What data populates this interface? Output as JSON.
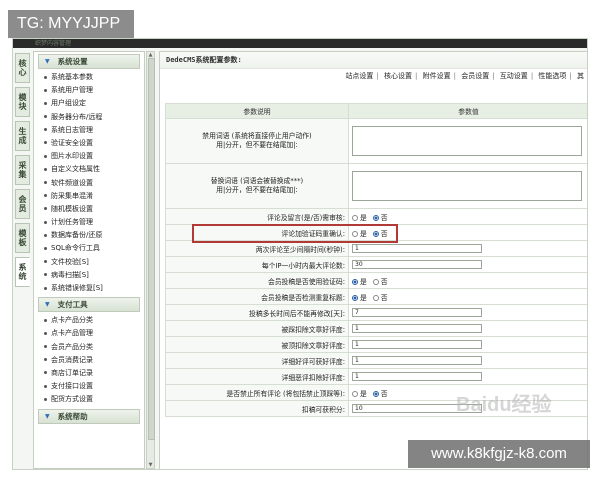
{
  "overlay": {
    "top_left": "TG: MYYJJPP",
    "bottom_right": "www.k8kfgjz-k8.com",
    "watermark": "Baidu经验"
  },
  "topbar": {
    "text": "织梦内容管理"
  },
  "vtabs": [
    "核心",
    "模块",
    "生成",
    "采集",
    "会员",
    "模板",
    "系统"
  ],
  "sidebar": {
    "section1": {
      "title": "系统设置",
      "items": [
        "系统基本参数",
        "系统用户管理",
        "用户组设定",
        "服务器分布/远程",
        "系统日志管理",
        "验证安全设置",
        "图片水印设置",
        "自定义文档属性",
        "软件频道设置",
        "防采集串混淆",
        "随机模板设置",
        "计划任务管理",
        "数据库备份/还原",
        "SQL命令行工具",
        "文件校验[S]",
        "病毒扫描[S]",
        "系统错误修复[S]"
      ]
    },
    "section2": {
      "title": "支付工具",
      "items": [
        "点卡产品分类",
        "点卡产品管理",
        "会员产品分类",
        "会员消费记录",
        "商店订单记录",
        "支付接口设置",
        "配货方式设置"
      ]
    },
    "section3": {
      "title": "系统帮助"
    }
  },
  "main": {
    "title": "DedeCMS系统配置参数:",
    "tabs": [
      "站点设置",
      "核心设置",
      "附件设置",
      "会员设置",
      "互动设置",
      "性能选项",
      "其"
    ],
    "col_label": "参数说明",
    "col_value": "参数值",
    "rows": [
      {
        "label1": "禁用词语 (系统将直接停止用户动作)",
        "label2": "用|分开，但不要在结尾加|:"
      },
      {
        "label1": "替换词语 (词语会被替换成***)",
        "label2": "用|分开，但不要在结尾加|:"
      },
      {
        "label": "评论及留言(是/否)需审核:",
        "yes": "是",
        "no": "否"
      },
      {
        "label": "评论加验证码重确认:",
        "yes": "是",
        "no": "否"
      },
      {
        "label": "两次评论至少间隔时间(秒钟):",
        "value": "1"
      },
      {
        "label": "每个IP一小时内最大评论数:",
        "value": "30"
      },
      {
        "label": "会员投稿是否使用验证码:",
        "yes": "是",
        "no": "否"
      },
      {
        "label": "会员投稿是否检测重复标题:",
        "yes": "是",
        "no": "否"
      },
      {
        "label": "投稿多长时间后不能再修改[天]:",
        "value": "7"
      },
      {
        "label": "被踩扣除文章好评度:",
        "value": "1"
      },
      {
        "label": "被顶扣除文章好评度:",
        "value": "1"
      },
      {
        "label": "详细好评可获好评度:",
        "value": "1"
      },
      {
        "label": "详细恶评扣除好评度:",
        "value": "1"
      },
      {
        "label": "是否禁止所有评论 (将包括禁止顶踩等):",
        "yes": "是",
        "no": "否"
      },
      {
        "label": "扣稿可获积分:",
        "value": "10"
      }
    ]
  }
}
